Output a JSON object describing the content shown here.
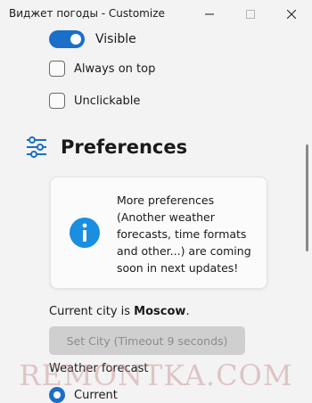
{
  "window": {
    "title": "Виджет погоды - Customize",
    "controls": [
      "minimize",
      "maximize",
      "close"
    ]
  },
  "visible_toggle": {
    "label": "Visible",
    "state": "on"
  },
  "options": [
    {
      "label": "Always on top",
      "checked": false
    },
    {
      "label": "Unclickable",
      "checked": false
    }
  ],
  "preferences": {
    "title": "Preferences",
    "icon": "sliders-icon",
    "info_text": "More preferences (Another weather forecasts, time formats and other...) are coming soon in next updates!",
    "info_icon": "info-icon"
  },
  "city": {
    "prefix": "Current city is ",
    "name": "Moscow",
    "suffix": "."
  },
  "set_city_button": {
    "label": "Set City (Timeout 9 seconds)",
    "disabled": true
  },
  "forecast": {
    "label": "Weather forecast",
    "options": [
      {
        "label": "Current",
        "selected": true
      }
    ]
  },
  "watermark": "REMONTKA.COM",
  "colors": {
    "accent": "#1a6fc9",
    "background": "#f3f3f3",
    "disabled_button": "#cfcfcf"
  }
}
